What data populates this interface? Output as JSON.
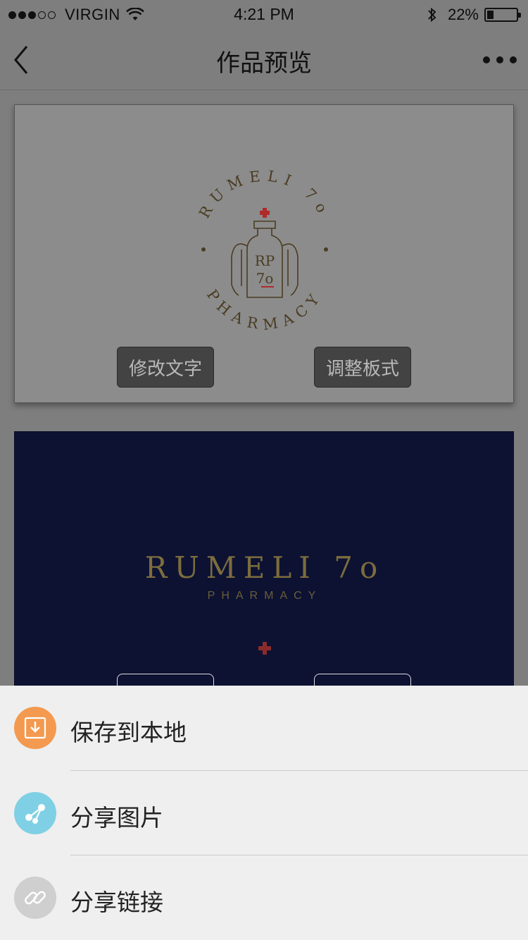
{
  "status_bar": {
    "carrier": "VIRGIN",
    "time": "4:21 PM",
    "battery": "22%",
    "battery_level": 0.22
  },
  "nav": {
    "title": "作品预览",
    "back_icon": "chevron-left-icon",
    "more_icon": "more-horizontal-icon"
  },
  "cards": [
    {
      "edit_label": "修改文字",
      "layout_label": "调整板式",
      "logo": {
        "ring_text_top": "RUMELI 7o",
        "ring_text_bottom": "PHARMACY",
        "badge_letters": "RP",
        "badge_number": "7o"
      }
    },
    {
      "edit_label": "修改文字",
      "layout_label": "调整板式",
      "wordmark": "RUMELI 7o",
      "subtitle": "PHARMACY"
    }
  ],
  "sheet": {
    "items": [
      {
        "label": "保存到本地",
        "icon": "download-icon",
        "color": "#f39a50"
      },
      {
        "label": "分享图片",
        "icon": "share-icon",
        "color": "#7fd0e4"
      },
      {
        "label": "分享链接",
        "icon": "link-icon",
        "color": "#cfcfcf"
      }
    ]
  },
  "colors": {
    "overlay_dim": "#7e7e7e",
    "accent_red": "#c0392b",
    "gold": "#7c6d3c",
    "navy": "#0d1233"
  }
}
